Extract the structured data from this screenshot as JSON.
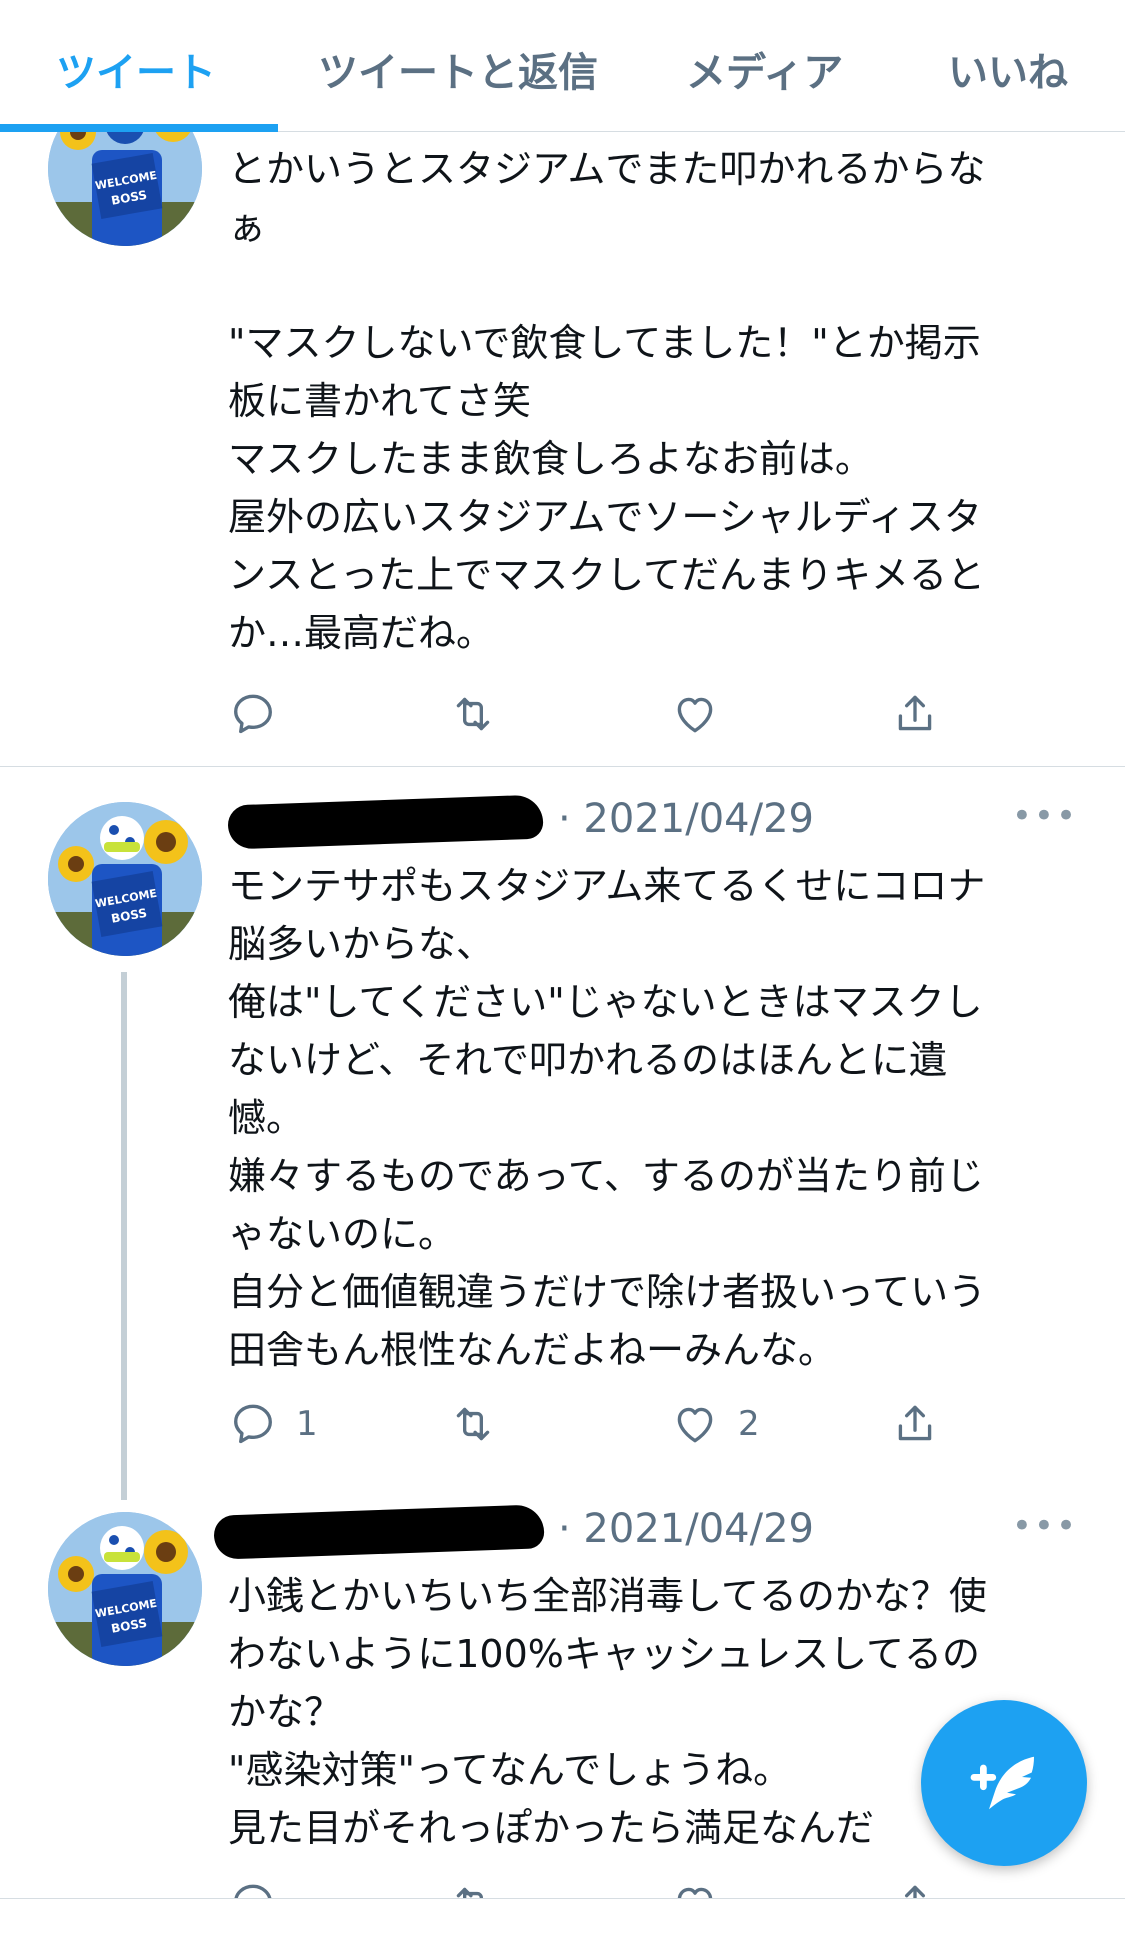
{
  "tabs": [
    "ツイート",
    "ツイートと返信",
    "メディア",
    "いいね"
  ],
  "colors": {
    "accent": "#1da1f2",
    "secondary_text": "#5b7083",
    "divider": "#d6dde2"
  },
  "tweets": [
    {
      "text": "とかいうとスタジアムでまた叩かれるからな\nぁ\n\n\"マスクしないで飲食してました！\"とか掲示\n板に書かれてさ笑\nマスクしたまま飲食しろよなお前は。\n屋外の広いスタジアムでソーシャルディスタ\nンスとった上でマスクしてだんまりキメると\nか…最高だね。",
      "reply_count": "",
      "retweet_count": "",
      "like_count": ""
    },
    {
      "date": "· 2021/04/29",
      "more": "•••",
      "text": "モンテサポもスタジアム来てるくせにコロナ\n脳多いからな、\n俺は\"してください\"じゃないときはマスクし\nないけど、それで叩かれるのはほんとに遺\n憾。\n嫌々するものであって、するのが当たり前じ\nゃないのに。\n自分と価値観違うだけで除け者扱いっていう\n田舎もん根性なんだよねーみんな。",
      "reply_count": "1",
      "retweet_count": "",
      "like_count": "2"
    },
    {
      "date": "· 2021/04/29",
      "more": "•••",
      "text": "小銭とかいちいち全部消毒してるのかな？使\nわないように100%キャッシュレスしてるの\nかな？\n\"感染対策\"ってなんでしょうね。\n見た目がそれっぽかったら満足なんだ",
      "reply_count": "",
      "retweet_count": "",
      "like_count": ""
    }
  ],
  "avatar": {
    "sign_text": "WELCOME BOSS",
    "icon": "avatar-sunflower-fan"
  },
  "fab": {
    "icon": "compose-tweet-icon"
  }
}
